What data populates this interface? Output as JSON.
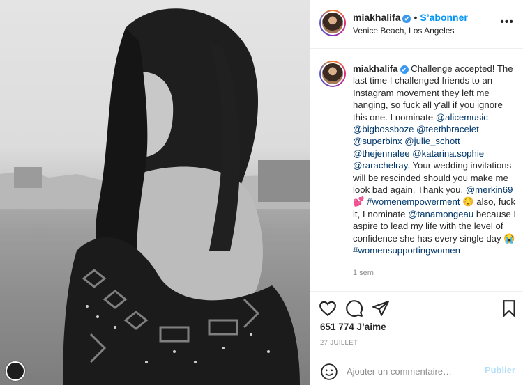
{
  "post": {
    "username": "miakhalifa",
    "verified_glyph": "✔",
    "follow_label": "S’abonner",
    "separator": "•",
    "location": "Venice Beach, Los Angeles",
    "more_icon": "more-horizontal-icon"
  },
  "caption": {
    "username": "miakhalifa",
    "t1": " Challenge accepted! The last time I challenged friends to an Instagram movement they left me hanging, so fuck all y’all if you ignore this one. I nominate ",
    "m1": "@alicemusic",
    "m2": "@bigbossboze",
    "m3": "@teethbracelet",
    "m4": "@superbinx",
    "m5": "@julie_schott",
    "m6": "@thejennalee",
    "m7": "@katarina.sophie",
    "m8": "@rarachelray",
    "t2": ". Your wedding invitations will be rescinded should you make me look bad again. Thank you, ",
    "m9": "@merkin69",
    "e1": "💕",
    "m10": "#womenempowerment",
    "e2": "☺️",
    "t3": " also, fuck it, I nominate ",
    "m11": "@tanamongeau",
    "t4": " because I aspire to lead my life with the level of confidence she has every single day ",
    "e3": "😭",
    "m12": "#womensupportingwomen"
  },
  "time_ago": "1 sem",
  "likes": "651 774 J’aime",
  "date": "27 JUILLET",
  "comment": {
    "placeholder": "Ajouter un commentaire…",
    "publish_label": "Publier"
  },
  "icons": [
    "heart-icon",
    "comment-icon",
    "share-icon",
    "bookmark-icon",
    "emoji-icon"
  ],
  "colors": {
    "link": "#0095f6",
    "mention": "#00376b",
    "publish_disabled": "#b2dffc",
    "muted": "#8e8e8e"
  }
}
